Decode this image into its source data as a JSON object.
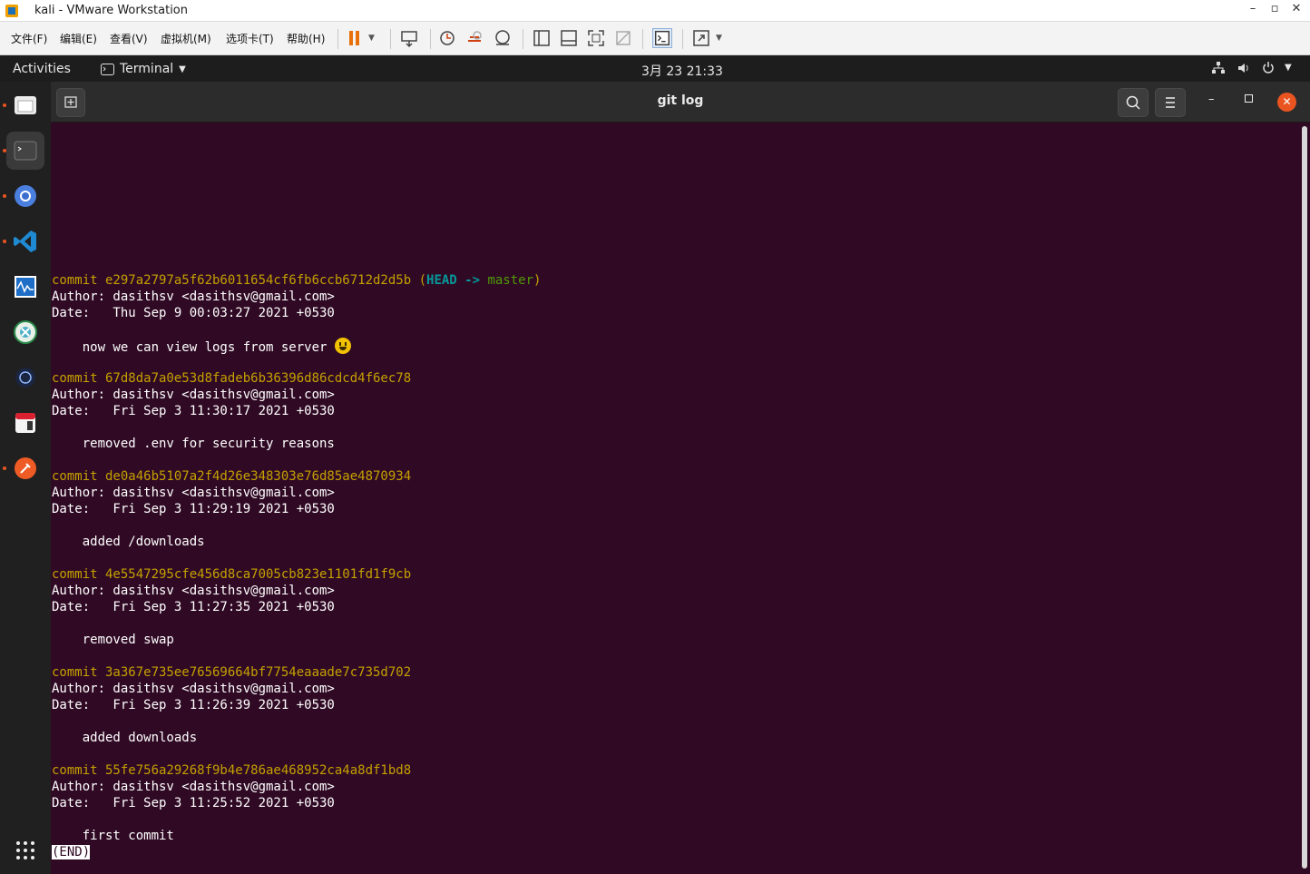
{
  "window": {
    "title": "kali - VMware Workstation"
  },
  "menu": [
    "文件(F)",
    "编辑(E)",
    "查看(V)",
    "虚拟机(M)",
    "选项卡(T)",
    "帮助(H)"
  ],
  "topbar": {
    "activities": "Activities",
    "app": "Terminal",
    "clock": "3月 23  21:33"
  },
  "terminal": {
    "title": "git log",
    "commits": [
      {
        "hash": "commit e297a2797a5f62b6011654cf6fb6ccb6712d2d5b",
        "ref_open": " (",
        "ref_head": "HEAD -> ",
        "ref_branch": "master",
        "ref_close": ")",
        "author": "Author: dasithsv <dasithsv@gmail.com>",
        "date": "Date:   Thu Sep 9 00:03:27 2021 +0530",
        "message": "    now we can view logs from server "
      },
      {
        "hash": "commit 67d8da7a0e53d8fadeb6b36396d86cdcd4f6ec78",
        "author": "Author: dasithsv <dasithsv@gmail.com>",
        "date": "Date:   Fri Sep 3 11:30:17 2021 +0530",
        "message": "    removed .env for security reasons"
      },
      {
        "hash": "commit de0a46b5107a2f4d26e348303e76d85ae4870934",
        "author": "Author: dasithsv <dasithsv@gmail.com>",
        "date": "Date:   Fri Sep 3 11:29:19 2021 +0530",
        "message": "    added /downloads"
      },
      {
        "hash": "commit 4e5547295cfe456d8ca7005cb823e1101fd1f9cb",
        "author": "Author: dasithsv <dasithsv@gmail.com>",
        "date": "Date:   Fri Sep 3 11:27:35 2021 +0530",
        "message": "    removed swap"
      },
      {
        "hash": "commit 3a367e735ee76569664bf7754eaaade7c735d702",
        "author": "Author: dasithsv <dasithsv@gmail.com>",
        "date": "Date:   Fri Sep 3 11:26:39 2021 +0530",
        "message": "    added downloads"
      },
      {
        "hash": "commit 55fe756a29268f9b4e786ae468952ca4a8df1bd8",
        "author": "Author: dasithsv <dasithsv@gmail.com>",
        "date": "Date:   Fri Sep 3 11:25:52 2021 +0530",
        "message": "    first commit"
      }
    ],
    "pager_status": "(END)"
  },
  "dock": [
    "files-icon",
    "terminal-icon",
    "chromium-icon",
    "vscode-icon",
    "system-monitor-icon",
    "crossover-icon",
    "app-icon",
    "app-icon-2",
    "postman-icon"
  ],
  "colors": {
    "terminal_bg": "#300a24",
    "hash": "#c4a000",
    "head": "#06989a",
    "branch": "#4e9a06",
    "accent": "#e95420"
  }
}
